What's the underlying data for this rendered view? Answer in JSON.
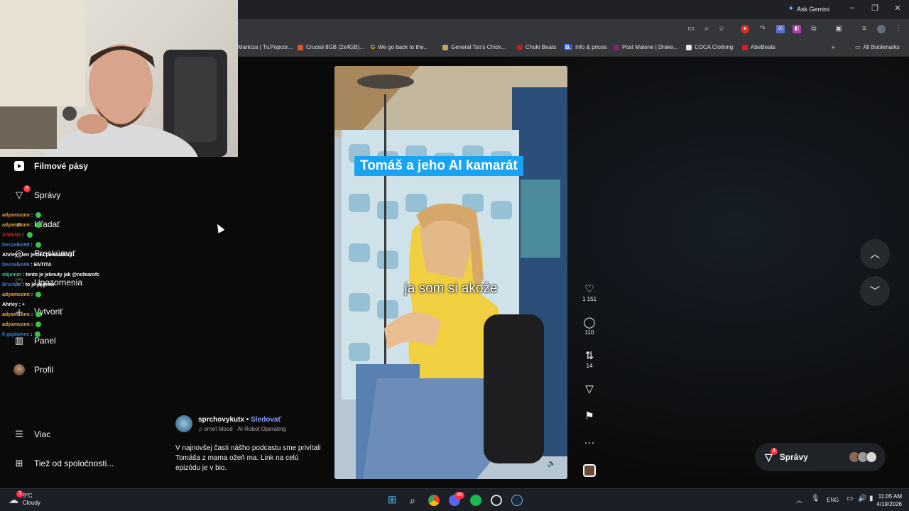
{
  "browser": {
    "ask_gemini": "Ask Gemini",
    "bookmarks": [
      "Markíza | Tv.Popcor...",
      "Crucial 8GB (2x4GB)...",
      "We go back to the...",
      "General Tso's Chick...",
      "Chuki Beats",
      "Info & prices",
      "Post Malone | Drake...",
      "COCA Clothing",
      "AbeBeats"
    ],
    "all_bookmarks": "All Bookmarks",
    "more_bookmarks": "»"
  },
  "sidebar": {
    "items": [
      {
        "label": "Filmové pásy",
        "icon": "reels-icon"
      },
      {
        "label": "Správy",
        "icon": "messenger-icon",
        "badge": "5"
      },
      {
        "label": "Hľadať",
        "icon": "search-icon"
      },
      {
        "label": "Preskúmať",
        "icon": "compass-icon"
      },
      {
        "label": "Upozornenia",
        "icon": "heart-icon"
      },
      {
        "label": "Vytvoriť",
        "icon": "plus-icon"
      },
      {
        "label": "Panel",
        "icon": "chart-icon"
      },
      {
        "label": "Profil",
        "icon": "avatar"
      },
      {
        "label": "Viac",
        "icon": "menu-icon"
      },
      {
        "label": "Tiež od spoločnosti...",
        "icon": "grid-icon"
      }
    ]
  },
  "chat": [
    {
      "user": "adyamsonn",
      "text": "",
      "color": "#e8a33c"
    },
    {
      "user": "adyamsonn",
      "text": "",
      "color": "#e8a33c"
    },
    {
      "user": "AiWeN3",
      "text": "",
      "color": "#d3202f"
    },
    {
      "user": "Denzelko99",
      "text": "",
      "color": "#3b7dd8"
    },
    {
      "user": "Ahrley",
      "text": "len je bez pokecatory",
      "color": "#ffffff"
    },
    {
      "user": "Denzelko99",
      "text": "ENTITA",
      "color": "#3b7dd8"
    },
    {
      "user": "objemm",
      "text": "tento je jebnuty jak @nofearofc",
      "color": "#39c3a0"
    },
    {
      "user": "Brunipa",
      "text": "to je ja grme",
      "color": "#3b7dd8"
    },
    {
      "user": "adyamsonn",
      "text": "",
      "color": "#e8a33c"
    },
    {
      "user": "Ahrley",
      "text": "+",
      "color": "#ffffff"
    },
    {
      "user": "adyamsonn",
      "text": "",
      "color": "#e8a33c"
    },
    {
      "user": "adyamsonn",
      "text": "",
      "color": "#e8a33c"
    },
    {
      "user": "8 gajdamec",
      "text": "",
      "color": "#3b7dd8"
    }
  ],
  "video": {
    "title": "Tomáš a jeho AI kamarát",
    "caption": "ja som si akože"
  },
  "actions": {
    "likes": "1 151",
    "comments": "110",
    "reposts": "14"
  },
  "post": {
    "username": "sprchovykutx",
    "separator": "•",
    "follow": "Sledovať",
    "audio": "ernet Mood · AI Robot Operating",
    "description": "V najnovšej časti nášho podcastu sme privítali Tomáša z mama ožeň ma. Link na celú epizódu je v bio."
  },
  "messages_pill": {
    "label": "Správy",
    "badge": "3"
  },
  "taskbar": {
    "weather_temp": "9°C",
    "weather_desc": "Cloudy",
    "weather_badge": "1",
    "lang": "ENG",
    "time": "11:05 AM",
    "date": "4/19/2026",
    "discord_badge": "99"
  }
}
